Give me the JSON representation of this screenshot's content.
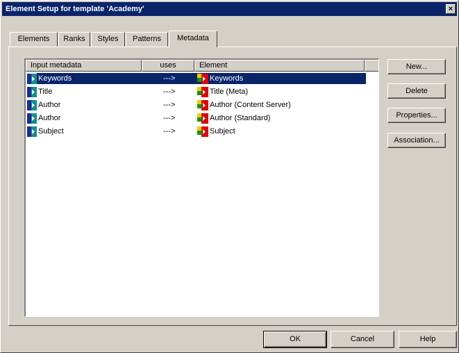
{
  "window": {
    "title": "Element Setup for template 'Academy'",
    "close_glyph": "×"
  },
  "tabs": [
    {
      "label": "Elements",
      "active": false
    },
    {
      "label": "Ranks",
      "active": false
    },
    {
      "label": "Styles",
      "active": false
    },
    {
      "label": "Patterns",
      "active": false
    },
    {
      "label": "Metadata",
      "active": true
    }
  ],
  "list": {
    "columns": [
      "Input metadata",
      "uses",
      "Element"
    ],
    "rows": [
      {
        "input": "Keywords",
        "uses": "--->",
        "element": "Keywords",
        "selected": true
      },
      {
        "input": "Title",
        "uses": "--->",
        "element": "Title (Meta)",
        "selected": false
      },
      {
        "input": "Author",
        "uses": "--->",
        "element": "Author (Content Server)",
        "selected": false
      },
      {
        "input": "Author",
        "uses": "--->",
        "element": "Author (Standard)",
        "selected": false
      },
      {
        "input": "Subject",
        "uses": "--->",
        "element": "Subject",
        "selected": false
      }
    ]
  },
  "side_buttons": [
    {
      "label": "New...",
      "mnemonic": "N"
    },
    {
      "label": "Delete",
      "mnemonic": "D"
    },
    {
      "label": "Properties...",
      "mnemonic": "P"
    },
    {
      "label": "Association...",
      "mnemonic": "A"
    }
  ],
  "footer_buttons": {
    "ok": "OK",
    "cancel": "Cancel",
    "help": "Help"
  },
  "icons": {
    "metadata_icon": "metadata-tag-icon",
    "element_icon": "element-tag-icon",
    "colors": {
      "selection": "#0a246a",
      "meta_blue": "#1c2a9c",
      "meta_teal": "#109090",
      "elem_red": "#e00000",
      "elem_yellow": "#e8d000",
      "elem_green": "#00a000"
    }
  }
}
